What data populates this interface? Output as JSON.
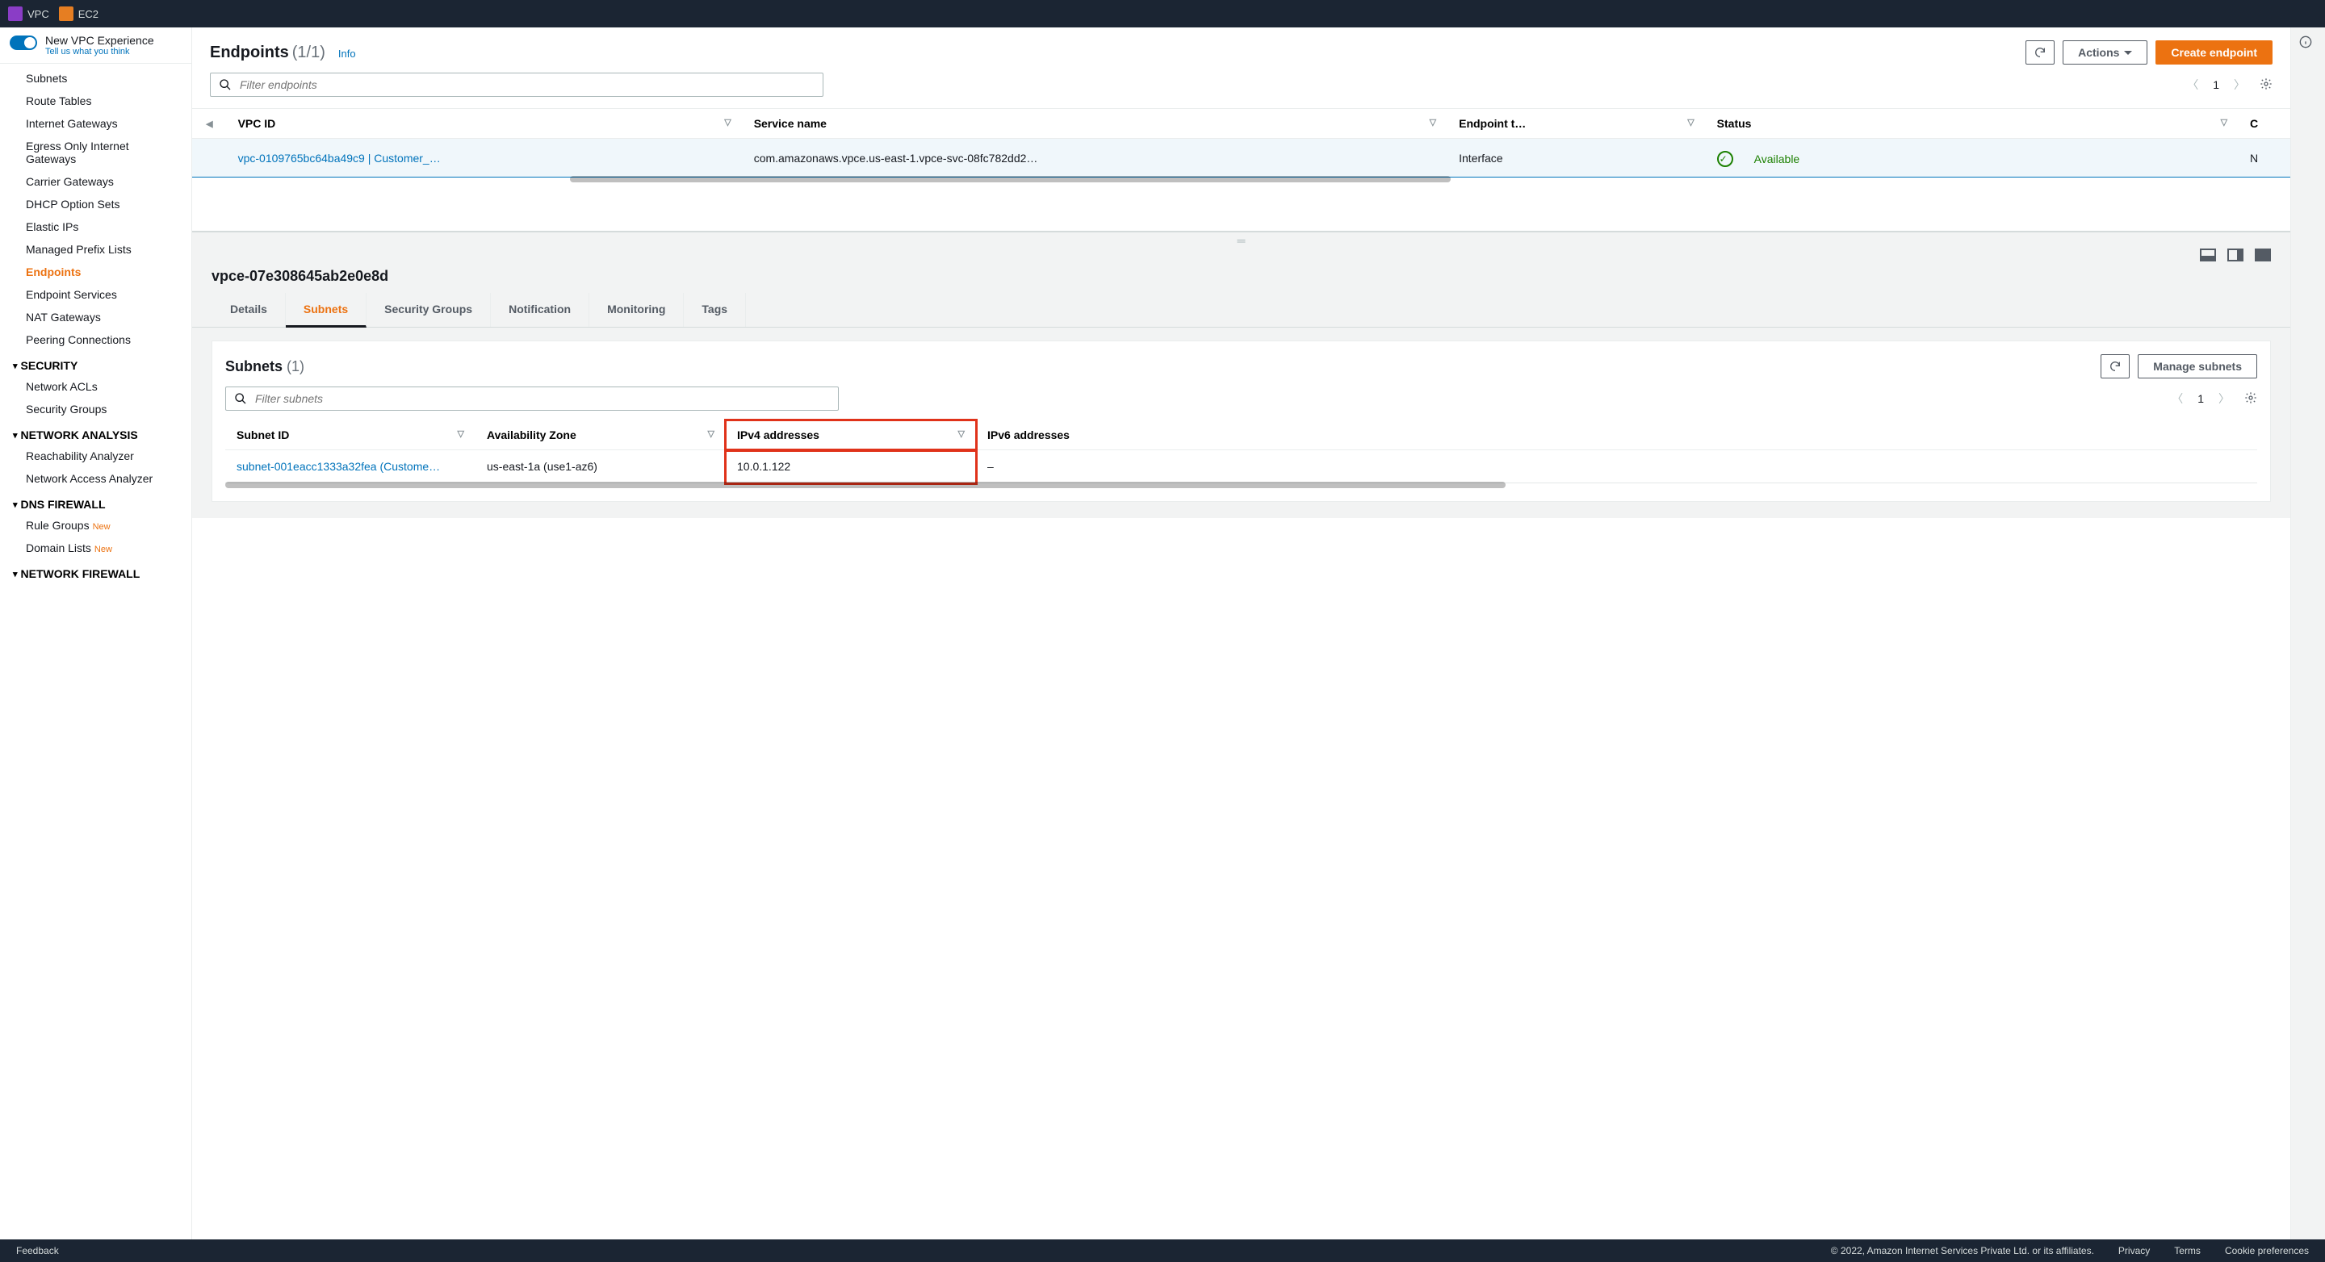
{
  "topbar": {
    "services": [
      {
        "name": "VPC",
        "icon": "vpc"
      },
      {
        "name": "EC2",
        "icon": "ec2"
      }
    ]
  },
  "sidebar": {
    "toggle_title": "New VPC Experience",
    "toggle_sub": "Tell us what you think",
    "items": [
      {
        "label": "Subnets",
        "type": "item"
      },
      {
        "label": "Route Tables",
        "type": "item"
      },
      {
        "label": "Internet Gateways",
        "type": "item"
      },
      {
        "label": "Egress Only Internet Gateways",
        "type": "item"
      },
      {
        "label": "Carrier Gateways",
        "type": "item"
      },
      {
        "label": "DHCP Option Sets",
        "type": "item"
      },
      {
        "label": "Elastic IPs",
        "type": "item"
      },
      {
        "label": "Managed Prefix Lists",
        "type": "item"
      },
      {
        "label": "Endpoints",
        "type": "item",
        "active": true
      },
      {
        "label": "Endpoint Services",
        "type": "item"
      },
      {
        "label": "NAT Gateways",
        "type": "item"
      },
      {
        "label": "Peering Connections",
        "type": "item"
      },
      {
        "label": "SECURITY",
        "type": "group"
      },
      {
        "label": "Network ACLs",
        "type": "item"
      },
      {
        "label": "Security Groups",
        "type": "item"
      },
      {
        "label": "NETWORK ANALYSIS",
        "type": "group"
      },
      {
        "label": "Reachability Analyzer",
        "type": "item"
      },
      {
        "label": "Network Access Analyzer",
        "type": "item"
      },
      {
        "label": "DNS FIREWALL",
        "type": "group"
      },
      {
        "label": "Rule Groups",
        "type": "item",
        "new": true
      },
      {
        "label": "Domain Lists",
        "type": "item",
        "new": true
      },
      {
        "label": "NETWORK FIREWALL",
        "type": "group"
      }
    ],
    "new_label": "New"
  },
  "page": {
    "title": "Endpoints",
    "count": "(1/1)",
    "info": "Info",
    "actions_label": "Actions",
    "create_label": "Create endpoint",
    "filter_placeholder": "Filter endpoints",
    "page_number": "1"
  },
  "table": {
    "columns": [
      "VPC ID",
      "Service name",
      "Endpoint t…",
      "Status",
      "C"
    ],
    "row": {
      "vpc": "vpc-0109765bc64ba49c9 | Customer_…",
      "service": "com.amazonaws.vpce.us-east-1.vpce-svc-08fc782dd2…",
      "type": "Interface",
      "status": "Available",
      "last": "N"
    }
  },
  "detail": {
    "id": "vpce-07e308645ab2e0e8d",
    "tabs": [
      "Details",
      "Subnets",
      "Security Groups",
      "Notification",
      "Monitoring",
      "Tags"
    ],
    "active_tab": 1,
    "subnets": {
      "title": "Subnets",
      "count": "(1)",
      "manage_label": "Manage subnets",
      "filter_placeholder": "Filter subnets",
      "page_number": "1",
      "columns": [
        "Subnet ID",
        "Availability Zone",
        "IPv4 addresses",
        "IPv6 addresses"
      ],
      "row": {
        "subnet": "subnet-001eacc1333a32fea (Custome…",
        "az": "us-east-1a (use1-az6)",
        "ipv4": "10.0.1.122",
        "ipv6": "–"
      }
    }
  },
  "footer": {
    "feedback": "Feedback",
    "copyright": "© 2022, Amazon Internet Services Private Ltd. or its affiliates.",
    "links": [
      "Privacy",
      "Terms",
      "Cookie preferences"
    ]
  }
}
